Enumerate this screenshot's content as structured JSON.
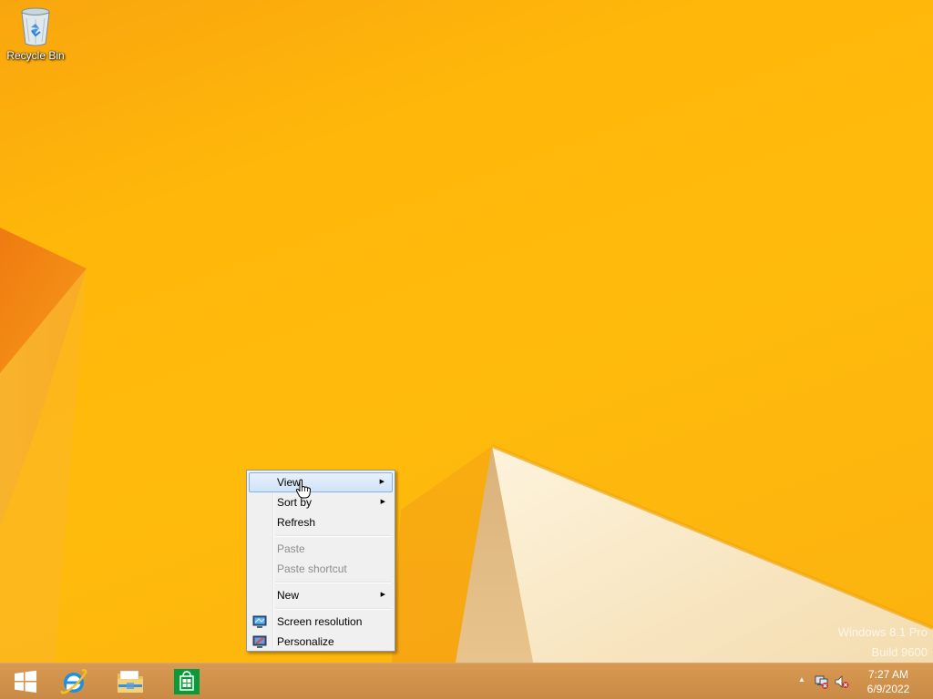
{
  "desktop": {
    "icons": [
      {
        "label": "Recycle Bin",
        "icon": "recycle-bin-icon"
      }
    ],
    "watermark": {
      "line1": "Windows 8.1 Pro",
      "line2": "Build 9600"
    },
    "wallpaper_color": "#ffb70a"
  },
  "context_menu": {
    "items": [
      {
        "label": "View",
        "submenu": true,
        "hover": true
      },
      {
        "label": "Sort by",
        "submenu": true
      },
      {
        "label": "Refresh"
      },
      {
        "label": "Paste",
        "disabled": true
      },
      {
        "label": "Paste shortcut",
        "disabled": true
      },
      {
        "label": "New",
        "submenu": true
      },
      {
        "label": "Screen resolution",
        "icon": "display-icon"
      },
      {
        "label": "Personalize",
        "icon": "personalize-icon"
      }
    ],
    "submenu_arrow": "▶"
  },
  "taskbar": {
    "pinned": [
      {
        "name": "start-button",
        "icon": "windows-logo-icon"
      },
      {
        "name": "internet-explorer",
        "icon": "internet-explorer-icon"
      },
      {
        "name": "file-explorer",
        "icon": "folder-icon"
      },
      {
        "name": "store",
        "icon": "store-icon"
      }
    ],
    "tray": {
      "show_hidden_arrow": "▲",
      "time": "7:27 AM",
      "date": "6/9/2022"
    }
  }
}
